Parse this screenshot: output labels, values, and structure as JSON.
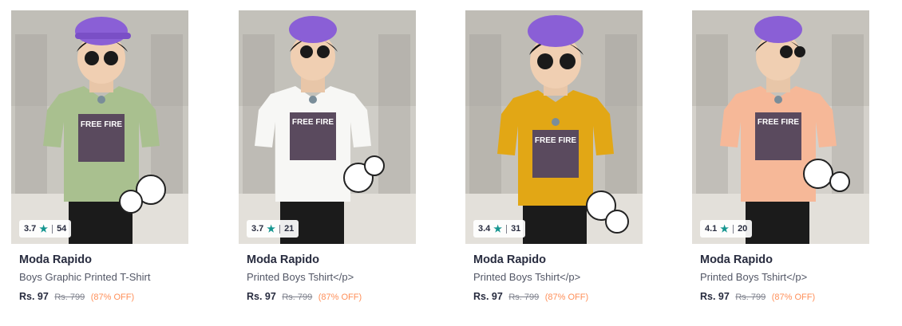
{
  "products": [
    {
      "brand": "Moda Rapido",
      "name": "Boys Graphic Printed T-Shirt",
      "price": "Rs. 97",
      "mrp": "Rs. 799",
      "discount": "(87% OFF)",
      "rating": "3.7",
      "rating_count": "54",
      "shirt_color": "#a9c08f",
      "bg_color": "#c9c7c0"
    },
    {
      "brand": "Moda Rapido",
      "name": "Printed Boys Tshirt</p>",
      "price": "Rs. 97",
      "mrp": "Rs. 799",
      "discount": "(87% OFF)",
      "rating": "3.7",
      "rating_count": "21",
      "shirt_color": "#f7f7f5",
      "bg_color": "#cfcdc7"
    },
    {
      "brand": "Moda Rapido",
      "name": "Printed Boys Tshirt</p>",
      "price": "Rs. 97",
      "mrp": "Rs. 799",
      "discount": "(87% OFF)",
      "rating": "3.4",
      "rating_count": "31",
      "shirt_color": "#e2a715",
      "bg_color": "#c6c3bc"
    },
    {
      "brand": "Moda Rapido",
      "name": "Printed Boys Tshirt</p>",
      "price": "Rs. 97",
      "mrp": "Rs. 799",
      "discount": "(87% OFF)",
      "rating": "4.1",
      "rating_count": "20",
      "shirt_color": "#f6b898",
      "bg_color": "#d4d1cb"
    }
  ],
  "graphic_text": "FREE FIRE",
  "icons": {
    "rating": "star-icon"
  },
  "colors": {
    "accent_star": "#14958f",
    "discount": "#ff905a"
  }
}
